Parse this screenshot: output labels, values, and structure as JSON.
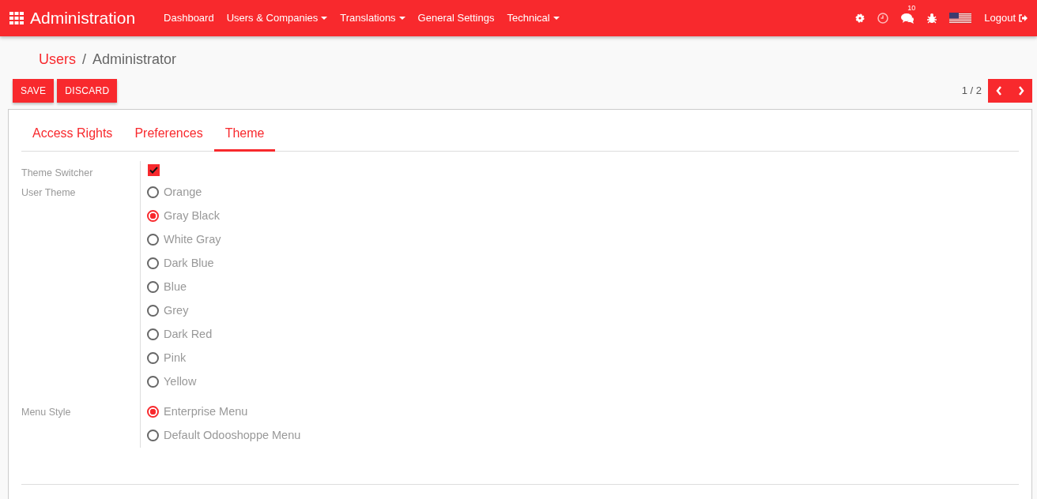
{
  "app_title": "Administration",
  "menu": [
    {
      "label": "Dashboard",
      "dropdown": false
    },
    {
      "label": "Users & Companies",
      "dropdown": true
    },
    {
      "label": "Translations",
      "dropdown": true
    },
    {
      "label": "General Settings",
      "dropdown": false
    },
    {
      "label": "Technical",
      "dropdown": true
    }
  ],
  "systray": {
    "message_count": "10",
    "logout": "Logout"
  },
  "breadcrumb": [
    {
      "label": "Users",
      "link": true
    },
    {
      "label": "Administrator",
      "link": false
    }
  ],
  "breadcrumb_separator": "/",
  "buttons": [
    "SAVE",
    "DISCARD"
  ],
  "pager": "1 / 2",
  "tabs": [
    {
      "label": "Access Rights",
      "selected": false
    },
    {
      "label": "Preferences",
      "selected": false
    },
    {
      "label": "Theme",
      "selected": true
    }
  ],
  "fields": [
    {
      "label": "Theme Switcher",
      "kind": "checkbox",
      "checked": true
    },
    {
      "label": "User Theme",
      "kind": "radio",
      "options": [
        {
          "label": "Orange",
          "selected": false
        },
        {
          "label": "Gray Black",
          "selected": true
        },
        {
          "label": "White Gray",
          "selected": false
        },
        {
          "label": "Dark Blue",
          "selected": false
        },
        {
          "label": "Blue",
          "selected": false
        },
        {
          "label": "Grey",
          "selected": false
        },
        {
          "label": "Dark Red",
          "selected": false
        },
        {
          "label": "Pink",
          "selected": false
        },
        {
          "label": "Yellow",
          "selected": false
        }
      ]
    },
    {
      "label": "Menu Style",
      "kind": "radio",
      "options": [
        {
          "label": "Enterprise Menu",
          "selected": true
        },
        {
          "label": "Default Odooshoppe Menu",
          "selected": false
        }
      ]
    }
  ]
}
